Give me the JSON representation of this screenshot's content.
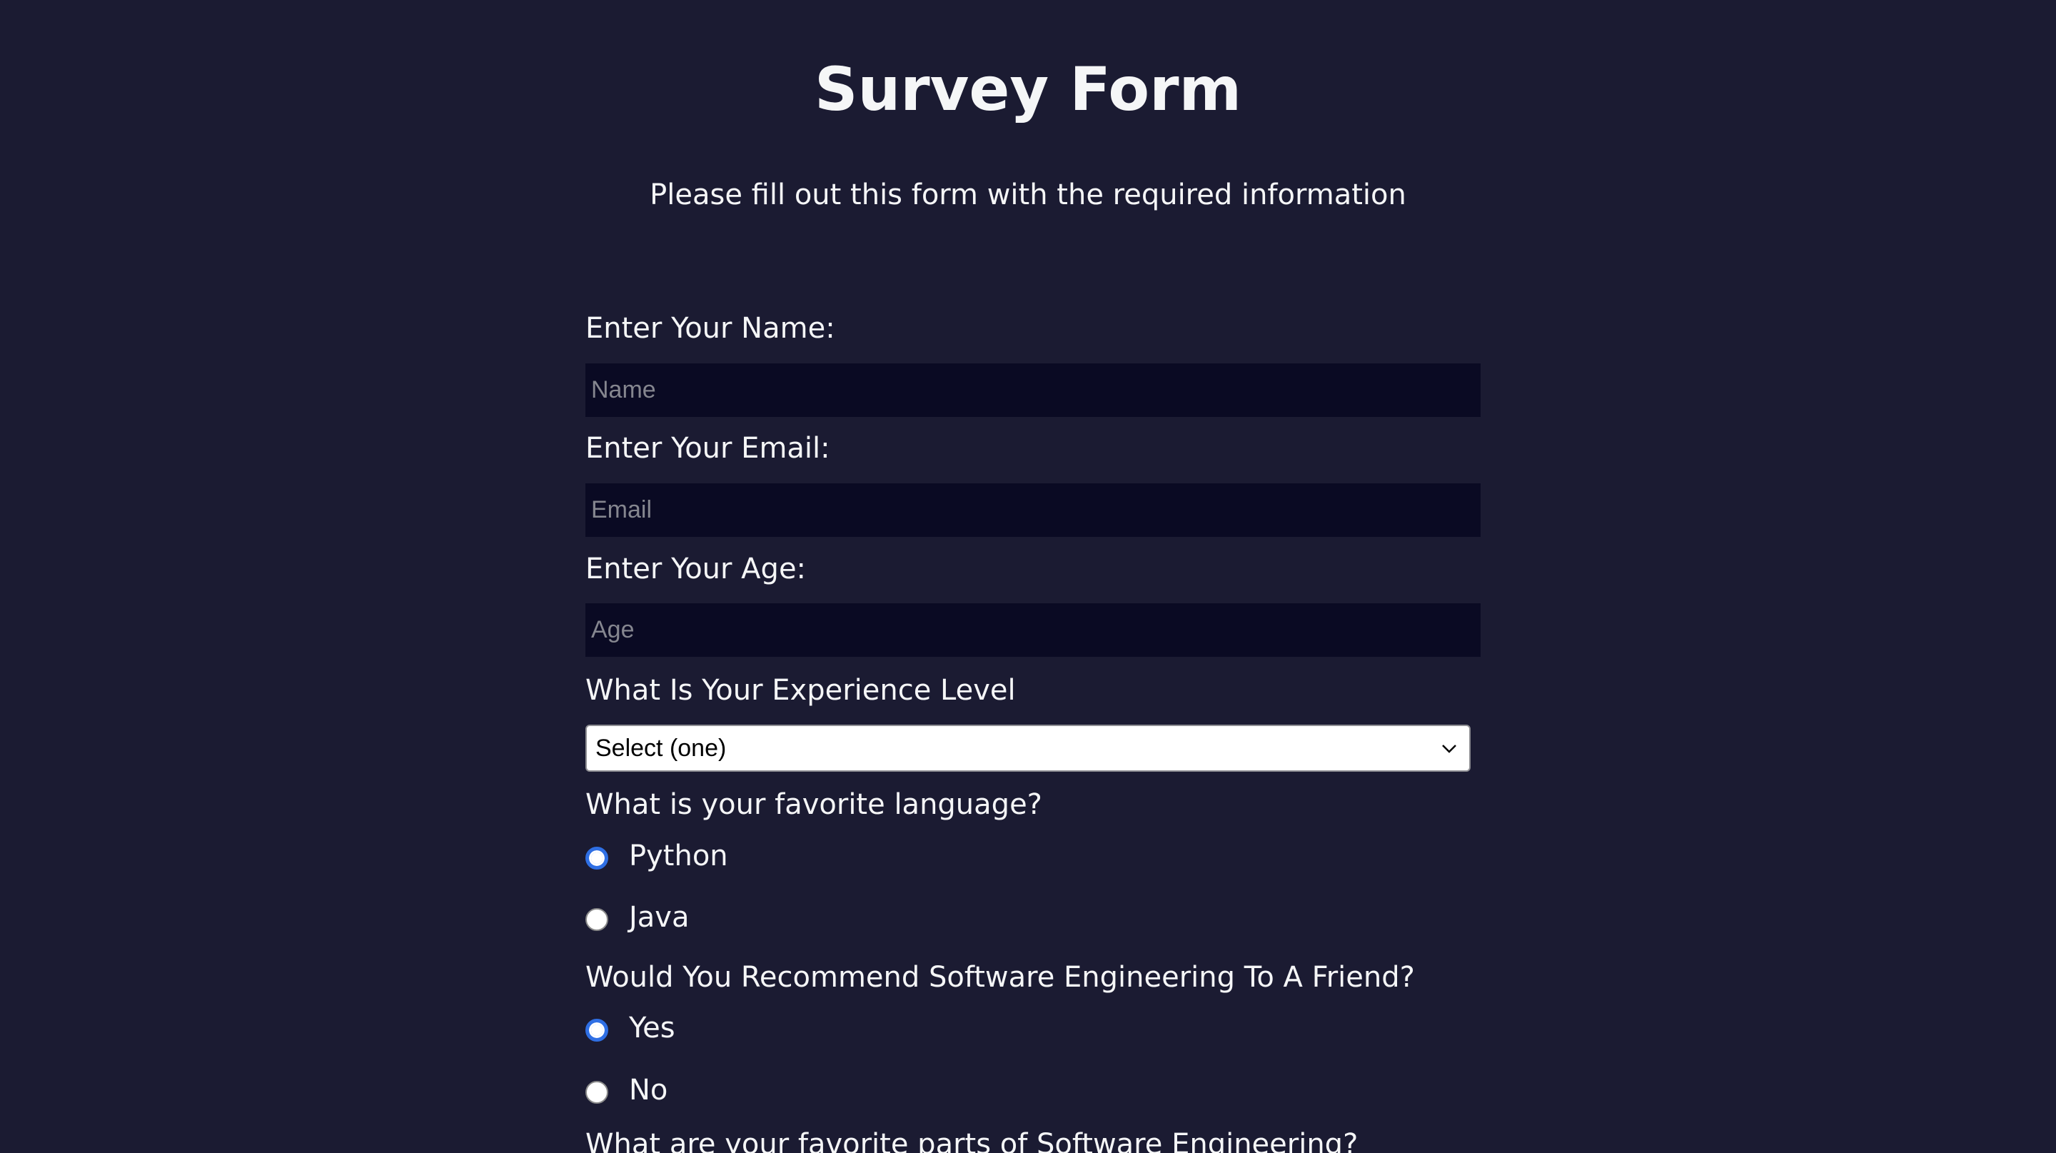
{
  "header": {
    "title": "Survey Form",
    "description": "Please fill out this form with the required information"
  },
  "form": {
    "name": {
      "label": "Enter Your Name:",
      "placeholder": "Name",
      "value": ""
    },
    "email": {
      "label": "Enter Your Email:",
      "placeholder": "Email",
      "value": ""
    },
    "age": {
      "label": "Enter Your Age:",
      "placeholder": "Age",
      "value": ""
    },
    "experience": {
      "label": "What Is Your Experience Level",
      "selected": "Select (one)"
    },
    "language": {
      "label": "What is your favorite language?",
      "options": [
        {
          "label": "Python",
          "checked": true
        },
        {
          "label": "Java",
          "checked": false
        }
      ]
    },
    "recommend": {
      "label": "Would You Recommend Software Engineering To A Friend?",
      "options": [
        {
          "label": "Yes",
          "checked": true
        },
        {
          "label": "No",
          "checked": false
        }
      ]
    },
    "favorite_parts": {
      "label": "What are your favorite parts of Software Engineering?"
    }
  },
  "icons": {
    "select_arrow": "chevron-down-icon"
  },
  "colors": {
    "background": "#1b1b32",
    "input_background": "#0a0a23",
    "text": "#f5f6f7",
    "radio_accent": "#2f6fe4"
  }
}
